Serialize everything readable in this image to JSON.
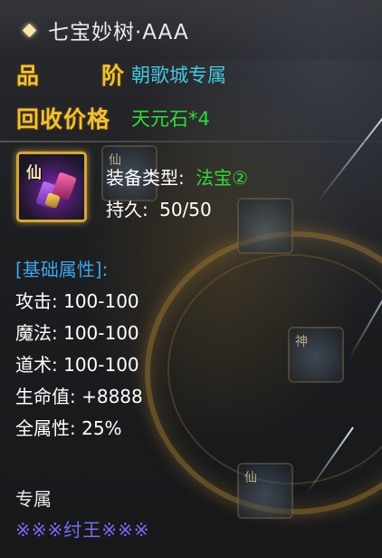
{
  "header": {
    "title": "七宝妙树·AAA"
  },
  "info": {
    "quality_label_1": "品",
    "quality_label_2": "阶",
    "quality_value": "朝歌城专属",
    "recycle_label": "回收价格",
    "recycle_value": "天元石*4"
  },
  "item": {
    "icon_badge": "仙",
    "type_label": "装备类型:",
    "type_value": "法宝②",
    "durability_label": "持久:",
    "durability_value": "50/50"
  },
  "attributes": {
    "section_title": "[基础属性]:",
    "lines": [
      "攻击: 100-100",
      "魔法: 100-100",
      "道术: 100-100",
      "生命值: +8888"
    ],
    "all_stats": "全属性: 25%"
  },
  "exclusive": {
    "label": "专属",
    "owner": "※※※纣王※※※"
  },
  "background_icons": {
    "top": "仙",
    "mid": "神",
    "bottom": "仙"
  },
  "colors": {
    "label_gold": "#f0c040",
    "value_cyan": "#45c8e0",
    "value_green": "#2fdc3a",
    "section_blue": "#3fa4ea",
    "owner_purple": "#7a6cf2"
  }
}
